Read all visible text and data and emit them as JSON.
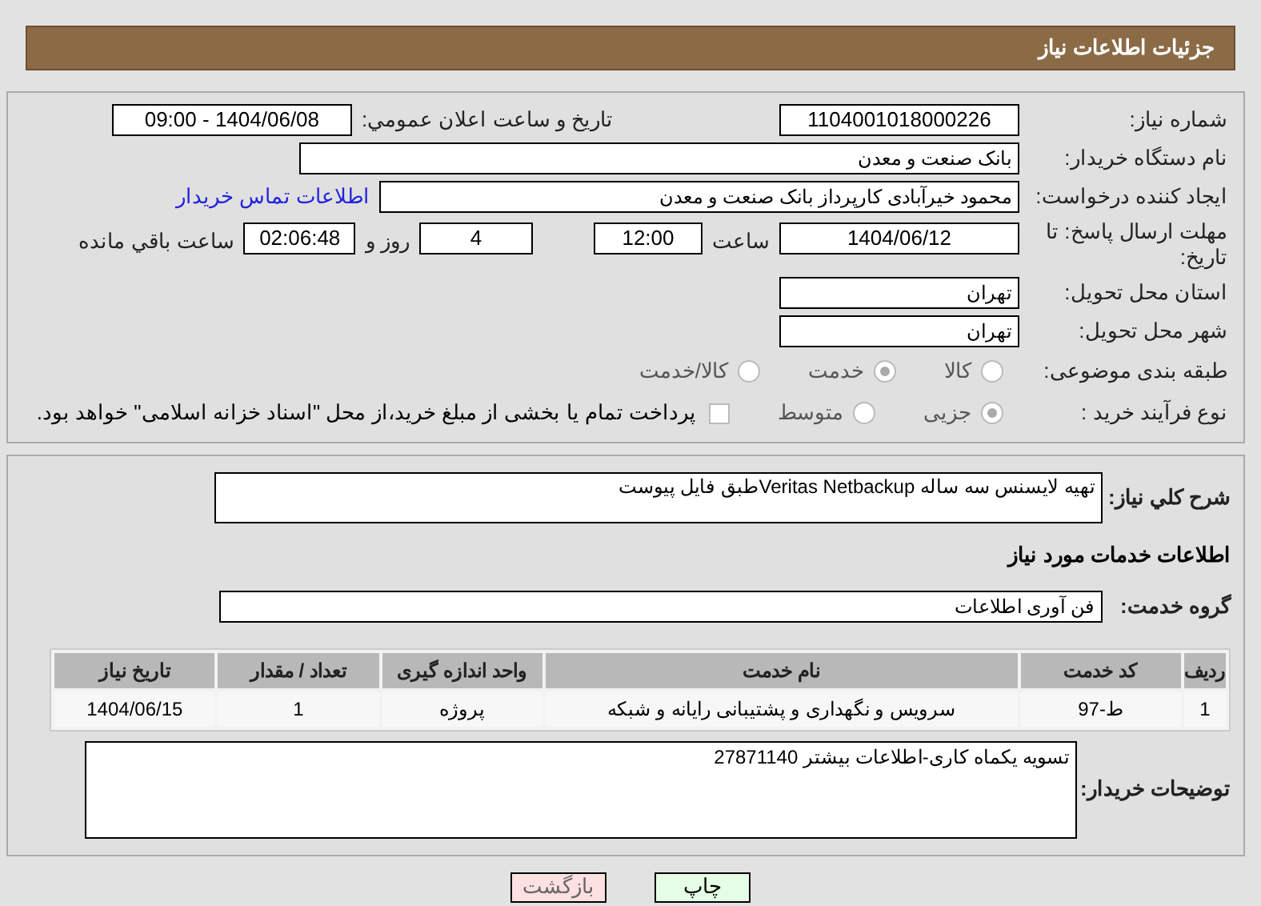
{
  "header": {
    "title": "جزئیات اطلاعات نیاز"
  },
  "details": {
    "need_number": {
      "label": "شماره نیاز:",
      "value": "1104001018000226"
    },
    "announce": {
      "label": "تاریخ و ساعت اعلان عمومي:",
      "value": "1404/06/08 - 09:00"
    },
    "buyer_org": {
      "label": "نام دستگاه خریدار:",
      "value": "بانک صنعت و معدن"
    },
    "requester": {
      "label": "ایجاد کننده درخواست:",
      "value": "محمود خیرآبادی کارپرداز بانک صنعت و معدن",
      "link": "اطلاعات تماس خریدار"
    },
    "deadline": {
      "label": "مهلت ارسال پاسخ: تا تاریخ:",
      "date": "1404/06/12",
      "time_label": "ساعت",
      "time": "12:00",
      "days": "4",
      "days_label": "روز و",
      "remaining": "02:06:48",
      "remaining_label": "ساعت باقي مانده"
    },
    "province": {
      "label": "استان محل تحویل:",
      "value": "تهران"
    },
    "city": {
      "label": "شهر محل تحویل:",
      "value": "تهران"
    },
    "category": {
      "label": "طبقه بندی موضوعی:",
      "options": [
        {
          "label": "کالا",
          "selected": false
        },
        {
          "label": "خدمت",
          "selected": true
        },
        {
          "label": "کالا/خدمت",
          "selected": false
        }
      ]
    },
    "purchase_type": {
      "label": "نوع فرآیند خرید :",
      "options": [
        {
          "label": "جزیی",
          "selected": true
        },
        {
          "label": "متوسط",
          "selected": false
        }
      ],
      "payment": {
        "checked": false,
        "text": "پرداخت تمام یا بخشی از مبلغ خرید،از محل \"اسناد خزانه اسلامی\" خواهد بود."
      }
    }
  },
  "description": {
    "label": "شرح کلي نياز:",
    "value": "تهیه لایسنس سه ساله Veritas Netbackupطبق فایل پیوست"
  },
  "services": {
    "heading": "اطلاعات خدمات مورد نیاز",
    "group_label": "گروه خدمت:",
    "group": "فن آوری اطلاعات",
    "columns": [
      "ردیف",
      "کد خدمت",
      "نام خدمت",
      "واحد اندازه گیری",
      "تعداد / مقدار",
      "تاریخ نیاز"
    ],
    "rows": [
      [
        "1",
        "ط-97",
        "سرویس و نگهداری و پشتیبانی رایانه و شبکه",
        "پروژه",
        "1",
        "1404/06/15"
      ]
    ]
  },
  "buyer_notes": {
    "label": "توضیحات خریدار:",
    "value": "تسویه یکماه کاری-اطلاعات بیشتر 27871140"
  },
  "buttons": [
    {
      "kind": "print",
      "label": "چاپ"
    },
    {
      "kind": "back",
      "label": "بازگشت"
    }
  ]
}
